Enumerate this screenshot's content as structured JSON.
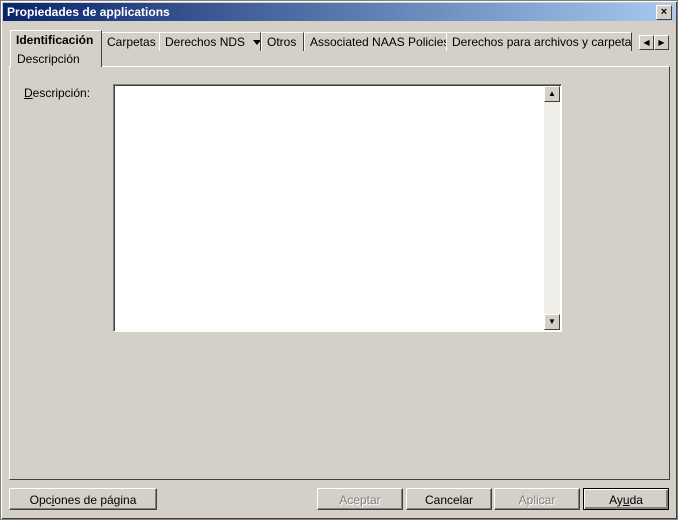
{
  "window": {
    "title": "Propiedades de applications",
    "close_glyph": "×"
  },
  "tabs": [
    {
      "label": "Identificación",
      "sub": "Descripción",
      "active": true
    },
    {
      "label": "Carpetas"
    },
    {
      "label": "Derechos NDS"
    },
    {
      "label": "Otros"
    },
    {
      "label": "Associated NAAS Policies"
    },
    {
      "label": "Derechos para archivos y carpetas"
    }
  ],
  "tab_scroll": {
    "left_glyph": "◀",
    "right_glyph": "▶"
  },
  "form": {
    "description_label_first": "D",
    "description_label_rest": "escripción:",
    "description_value": ""
  },
  "scrollbar": {
    "up_glyph": "▲",
    "down_glyph": "▼"
  },
  "buttons": {
    "page_options_pre": "Opc",
    "page_options_ul": "i",
    "page_options_post": "ones de página",
    "accept": "Aceptar",
    "cancel": "Cancelar",
    "apply": "Aplicar",
    "help_pre": "Ay",
    "help_ul": "u",
    "help_post": "da"
  }
}
